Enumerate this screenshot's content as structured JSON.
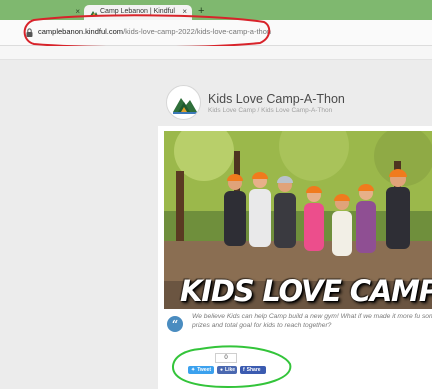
{
  "browser": {
    "previous_tab": {
      "close_glyph": "×"
    },
    "active_tab": {
      "title": "Camp Lebanon | Kindful",
      "close_glyph": "×",
      "favicon": "camp-logo-icon"
    },
    "new_tab_glyph": "+",
    "address": {
      "host": "camplebanon.kindful.com",
      "path": "/kids-love-camp-2022/kids-love-camp-a-thon"
    }
  },
  "page": {
    "title": "Kids Love Camp-A-Thon",
    "breadcrumb": "Kids Love Camp / Kids Love Camp-A-Thon",
    "hero_text": "KIDS LOVE CAMP-A-TH",
    "quote_glyph": "“",
    "description": "We believe Kids can help Camp build a new gym! What if we made it more fu some prizes and total goal for kids to reach together?",
    "share": {
      "count": "0",
      "tweet_label": "Tweet",
      "like_label": "Like",
      "share_label": "Share"
    }
  },
  "colors": {
    "tab_strip": "#7fb86f",
    "annotation_red": "#d8232a",
    "annotation_green": "#33c43a",
    "twitter": "#3ba1ee",
    "facebook": "#4a68b0"
  }
}
